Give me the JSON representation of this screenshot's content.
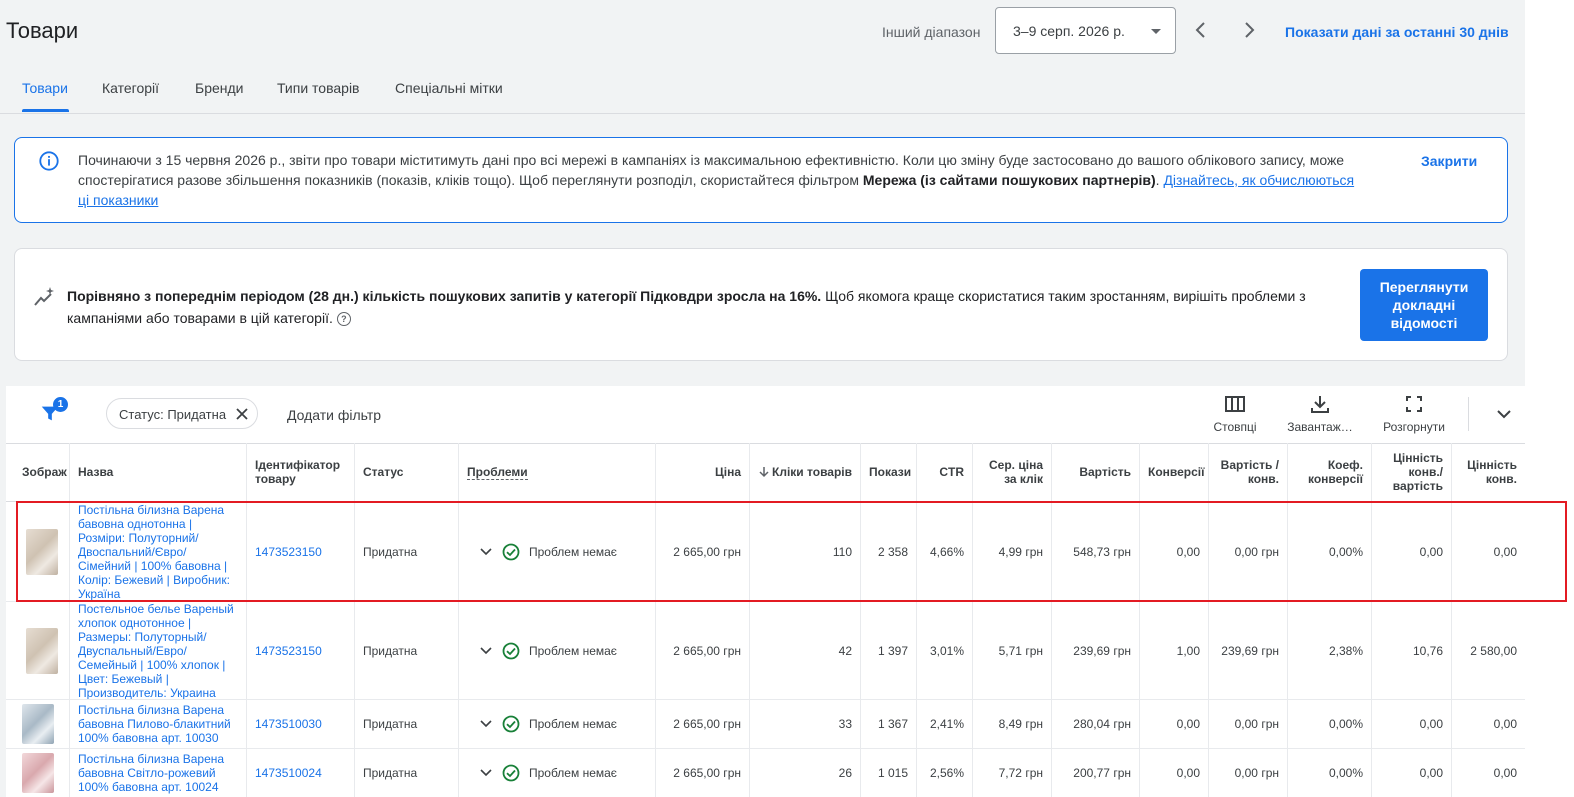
{
  "header": {
    "title": "Товари",
    "range_label": "Інший діапазон",
    "date_range": "3–9 серп. 2026 р.",
    "last30_link": "Показати дані за останні 30 днів"
  },
  "tabs": [
    {
      "label": "Товари",
      "active": true
    },
    {
      "label": "Категорії"
    },
    {
      "label": "Бренди"
    },
    {
      "label": "Типи товарів"
    },
    {
      "label": "Спеціальні мітки"
    }
  ],
  "info_banner": {
    "text_1": "Починаючи з 15 червня 2026 р., звіти про товари міститимуть дані про всі мережі в кампаніях із максимальною ефективністю. Коли цю зміну буде застосовано до вашого облікового запису, може спостерігатися разове збільшення показників (показів, кліків тощо). Щоб переглянути розподіл, скористайтеся фільтром ",
    "bold": "Мережа (із сайтами пошукових партнерів)",
    "text_2": ". ",
    "link": "Дізнайтесь, як обчислюються ці показники",
    "close": "Закрити"
  },
  "insight": {
    "bold": "Порівняно з попереднім періодом (28 дн.) кількість пошукових запитів у категорії Підковдри зросла на 16%.",
    "text": " Щоб якомога краще скористатися таким зростанням, вирішіть проблеми з кампаніями або товарами в цій категорії.",
    "help_icon": "?",
    "button": "Переглянути докладні відомості"
  },
  "toolbar": {
    "filter_count": "1",
    "chip_label": "Статус: Придатна",
    "add_filter": "Додати фільтр",
    "columns": "Стовпці",
    "download": "Завантаж…",
    "expand": "Розгорнути"
  },
  "columns": {
    "image": "Зображ",
    "name": "Назва",
    "id": "Ідентифікатор товару",
    "status": "Статус",
    "issues": "Проблеми",
    "price": "Ціна",
    "clicks": "Кліки товарів",
    "impr": "Покази",
    "ctr": "CTR",
    "cpc": "Сер. ціна за клік",
    "cost": "Вартість",
    "conv": "Конверсії",
    "cost_conv": "Вартість / конв.",
    "conv_rate": "Коеф. конверсії",
    "value_cost": "Цінність конв./ вартість",
    "value": "Цінність конв."
  },
  "rows": [
    {
      "name": "Постільна білизна Варена бавовна однотонна | Розміри: Полуторний/ Двоспальний/Євро/ Сімейний | 100% бавовна | Колір: Бежевий | Виробник: Україна",
      "id": "1473523150",
      "status": "Придатна",
      "issues": "Проблем немає",
      "price": "2 665,00 грн",
      "clicks": "110",
      "impr": "2 358",
      "ctr": "4,66%",
      "cpc": "4,99 грн",
      "cost": "548,73 грн",
      "conv": "0,00",
      "cost_conv": "0,00 грн",
      "conv_rate": "0,00%",
      "value_cost": "0,00",
      "value": "0,00"
    },
    {
      "name": "Постельное белье Вареный хлопок однотонное | Размеры: Полуторный/ Двуспальный/Евро/ Семейный | 100% хлопок | Цвет: Бежевый | Производитель: Украина",
      "id": "1473523150",
      "status": "Придатна",
      "issues": "Проблем немає",
      "price": "2 665,00 грн",
      "clicks": "42",
      "impr": "1 397",
      "ctr": "3,01%",
      "cpc": "5,71 грн",
      "cost": "239,69 грн",
      "conv": "1,00",
      "cost_conv": "239,69 грн",
      "conv_rate": "2,38%",
      "value_cost": "10,76",
      "value": "2 580,00"
    },
    {
      "name": "Постільна білизна Варена бавовна Пилово-блакитний 100% бавовна арт. 10030",
      "id": "1473510030",
      "status": "Придатна",
      "issues": "Проблем немає",
      "price": "2 665,00 грн",
      "clicks": "33",
      "impr": "1 367",
      "ctr": "2,41%",
      "cpc": "8,49 грн",
      "cost": "280,04 грн",
      "conv": "0,00",
      "cost_conv": "0,00 грн",
      "conv_rate": "0,00%",
      "value_cost": "0,00",
      "value": "0,00"
    },
    {
      "name": "Постільна білизна Варена бавовна Світло-рожевий 100% бавовна арт. 10024",
      "id": "1473510024",
      "status": "Придатна",
      "issues": "Проблем немає",
      "price": "2 665,00 грн",
      "clicks": "26",
      "impr": "1 015",
      "ctr": "2,56%",
      "cpc": "7,72 грн",
      "cost": "200,77 грн",
      "conv": "0,00",
      "cost_conv": "0,00 грн",
      "conv_rate": "0,00%",
      "value_cost": "0,00",
      "value": "0,00"
    }
  ],
  "colors": {
    "accent": "#1a73e8",
    "highlight": "#e31b23",
    "ok": "#188038"
  }
}
